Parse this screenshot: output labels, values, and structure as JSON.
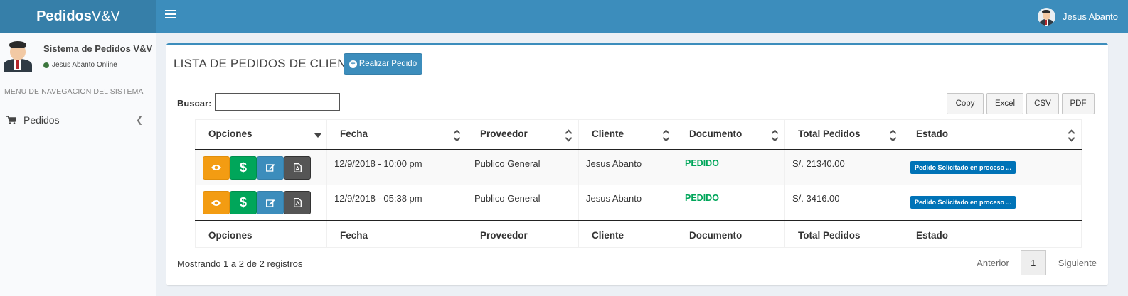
{
  "header": {
    "logo_bold": "Pedidos",
    "logo_light": "V&V",
    "user_name": "Jesus Abanto"
  },
  "sidebar": {
    "system_name": "Sistema de Pedidos V&V",
    "status": "Jesus Abanto Online",
    "menu_header": "MENU DE NAVEGACION DEL SISTEMA",
    "items": [
      {
        "label": "Pedidos",
        "icon": "cart-icon"
      }
    ]
  },
  "main": {
    "title": "LISTA DE PEDIDOS DE CLIENTES",
    "new_button": "Realizar Pedido",
    "search_label": "Buscar:",
    "search_value": "",
    "exports": [
      "Copy",
      "Excel",
      "CSV",
      "PDF"
    ],
    "columns": [
      "Opciones",
      "Fecha",
      "Proveedor",
      "Cliente",
      "Documento",
      "Total Pedidos",
      "Estado"
    ],
    "rows": [
      {
        "fecha": "12/9/2018 - 10:00 pm",
        "proveedor": "Publico General",
        "cliente": "Jesus Abanto",
        "documento": "PEDIDO",
        "total": "S/. 21340.00",
        "estado": "Pedido Solicitado en proceso ..."
      },
      {
        "fecha": "12/9/2018 - 05:38 pm",
        "proveedor": "Publico General",
        "cliente": "Jesus Abanto",
        "documento": "PEDIDO",
        "total": "S/. 3416.00",
        "estado": "Pedido Solicitado en proceso ..."
      }
    ],
    "info": "Mostrando 1 a 2 de 2 registros",
    "pagination": {
      "prev": "Anterior",
      "current": "1",
      "next": "Siguiente"
    }
  },
  "colors": {
    "header": "#3c8dbc",
    "logo_bg": "#367fa9",
    "view": "#f39c12",
    "pay": "#00a65a",
    "edit": "#3c8dbc",
    "pdf": "#555555",
    "badge": "#0073b7"
  }
}
